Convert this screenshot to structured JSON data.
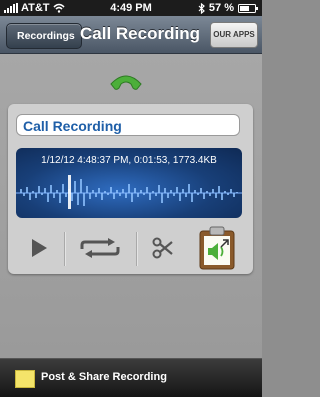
{
  "status_bar": {
    "carrier": "AT&T",
    "time": "4:49 PM",
    "battery": "57 %"
  },
  "nav": {
    "back_label": "Recordings",
    "title": "Call Recording",
    "apps_label": "OUR APPS"
  },
  "recording": {
    "name": "Call Recording",
    "info": "1/12/12 4:48:37 PM, 0:01:53, 1773.4KB"
  },
  "controls": {
    "play_icon": "play-icon",
    "repeat_icon": "repeat-icon",
    "trim_icon": "scissors-icon",
    "share_icon": "clipboard-speaker-icon"
  },
  "bottom_bar": {
    "label": "Post & Share Recording"
  },
  "colors": {
    "accent_green": "#4caf3a",
    "title_blue": "#1f5fa8",
    "clipboard_brown": "#8a5a2b"
  }
}
